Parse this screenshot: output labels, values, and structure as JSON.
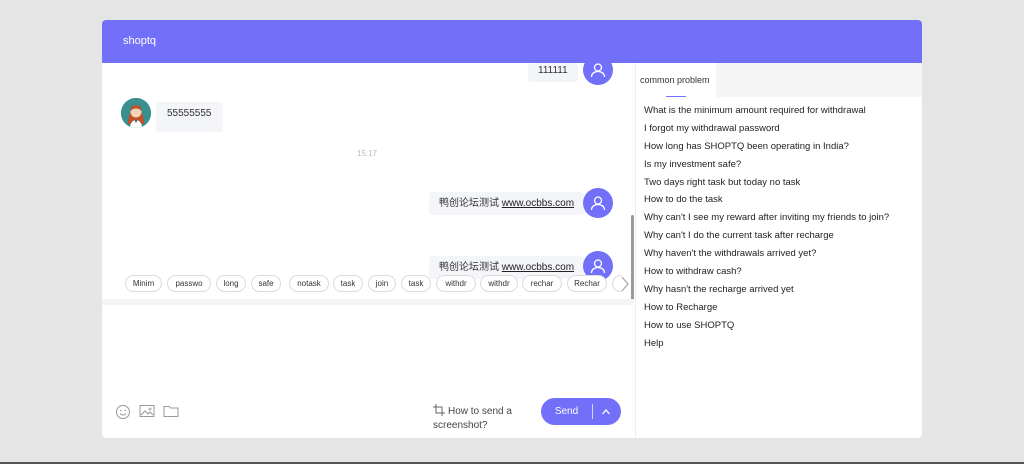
{
  "window": {
    "title": "shoptq"
  },
  "chat": {
    "messages": [
      {
        "from": "user",
        "text": "111111"
      },
      {
        "from": "agent",
        "text": "55555555"
      },
      {
        "from": "user",
        "text_prefix": "鸭创论坛测试 ",
        "link": "www.ocbbs.com"
      },
      {
        "from": "user",
        "text_prefix": "鸭创论坛测试 ",
        "link": "www.ocbbs.com"
      }
    ],
    "timestamp": "15:17"
  },
  "quick_replies": [
    "Minim",
    "passwo",
    "long",
    "safe",
    "notask",
    "task",
    "join",
    "task",
    "withdr",
    "withdr",
    "rechar",
    "Rechar"
  ],
  "composer": {
    "icons": [
      "emoji-icon",
      "image-icon",
      "folder-icon"
    ],
    "screenshot_hint": "How to send a screenshot?",
    "send_label": "Send"
  },
  "faq": {
    "tab_label": "common problem",
    "items": [
      "What is the minimum amount required for withdrawal",
      "I forgot my withdrawal password",
      "How long has SHOPTQ been operating in India?",
      "Is my investment safe?",
      "Two days right task but today no task",
      "How to do the task",
      "Why can't I see my reward after inviting my friends to join?",
      "Why can't I do the current task after recharge",
      "Why haven't the withdrawals arrived yet?",
      "How to withdraw cash?",
      "Why hasn't the recharge arrived yet",
      "How to Recharge",
      "How to use SHOPTQ",
      "Help"
    ]
  },
  "colors": {
    "accent": "#7270f8",
    "bubble": "#f3f5f8",
    "page_bg": "#e5e5e5"
  }
}
